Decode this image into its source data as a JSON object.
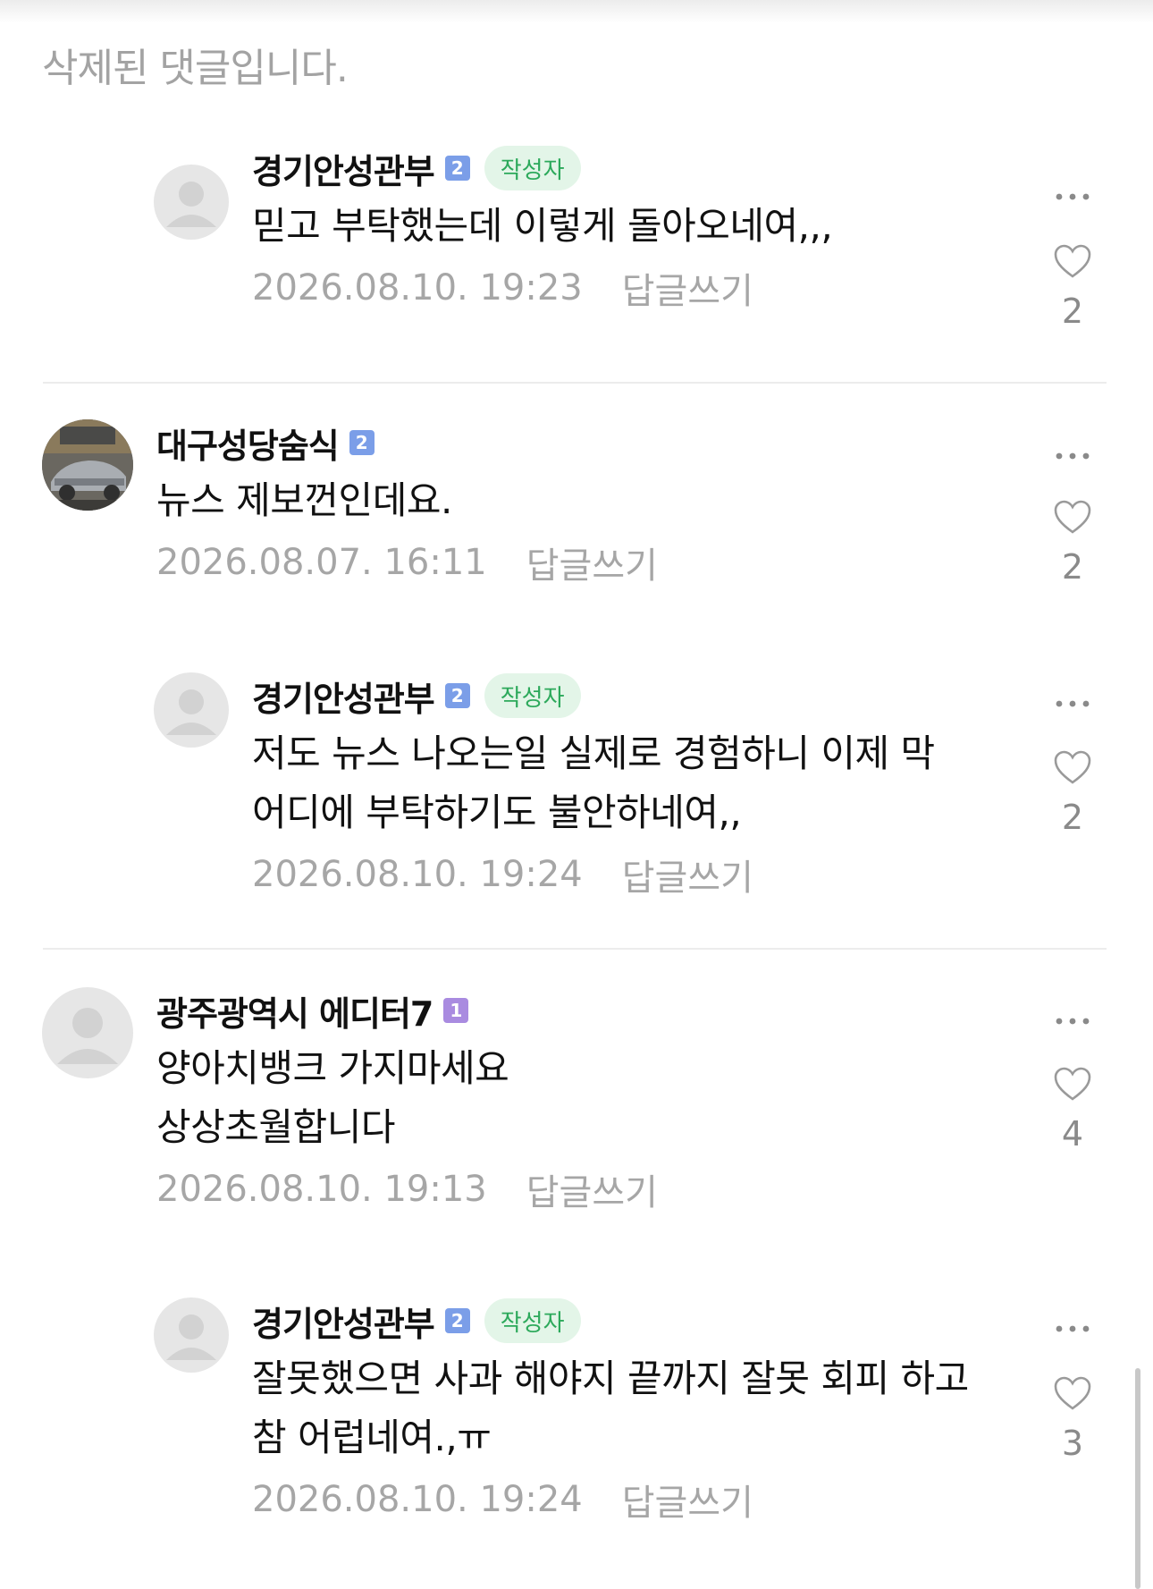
{
  "deleted_notice": "삭제된 댓글입니다.",
  "reply_label": "답글쓰기",
  "author_badge": "작성자",
  "comments": [
    {
      "nickname": "경기안성관부",
      "level": "2",
      "author": true,
      "lines": [
        "믿고 부탁했는데 이렇게 돌아오네여,,,"
      ],
      "date": "2026.08.10. 19:23",
      "likes": "2"
    },
    {
      "nickname": "대구성당숨식",
      "level": "2",
      "author": false,
      "lines": [
        "뉴스 제보껀인데요."
      ],
      "date": "2026.08.07. 16:11",
      "likes": "2"
    },
    {
      "nickname": "경기안성관부",
      "level": "2",
      "author": true,
      "lines": [
        "저도 뉴스 나오는일 실제로 경험하니 이제 막",
        "어디에 부탁하기도 불안하네여,,"
      ],
      "date": "2026.08.10. 19:24",
      "likes": "2"
    },
    {
      "nickname": "광주광역시 에디터7",
      "level": "1",
      "author": false,
      "lines": [
        "양아치뱅크 가지마세요",
        "상상초월합니다"
      ],
      "date": "2026.08.10. 19:13",
      "likes": "4"
    },
    {
      "nickname": "경기안성관부",
      "level": "2",
      "author": true,
      "lines": [
        "잘못했으면 사과 해야지 끝까지 잘못 회피 하고",
        "참 어럽네여.,ㅠ"
      ],
      "date": "2026.08.10. 19:24",
      "likes": "3"
    }
  ],
  "colors": {
    "level_2": "#7b9ee8",
    "level_1": "#a98be0",
    "author_badge_bg": "#e3f5e8",
    "author_badge_text": "#2ca95b"
  },
  "icons": {
    "more": "more-dots-icon",
    "like": "heart-outline-icon",
    "avatar": "default-avatar-icon"
  }
}
